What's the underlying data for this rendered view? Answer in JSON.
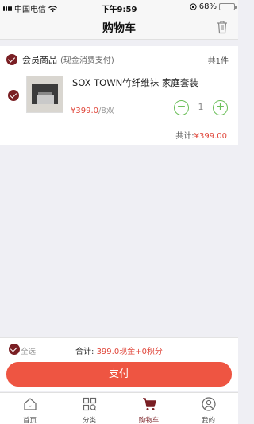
{
  "status_bar": {
    "carrier": "中国电信",
    "time": "下午9:59",
    "battery_percent": "68%",
    "battery_level": 0.68
  },
  "header": {
    "title": "购物车"
  },
  "cart": {
    "group_title": "会员商品",
    "group_subtitle": "(现金消费支付)",
    "item_count": "共1件",
    "item": {
      "name": "SOX TOWN竹纤维袜 家庭套装",
      "price": "¥399.0",
      "unit": "/8双",
      "quantity": "1"
    },
    "group_total_label": "共计:",
    "group_total_amount": "¥399.00"
  },
  "checkout": {
    "select_all_label": "全选",
    "sum_label": "合计:",
    "sum_amount": "399.0现金+0积分",
    "pay_label": "支付"
  },
  "tabbar": {
    "tabs": [
      {
        "label": "首页",
        "icon": "home-icon"
      },
      {
        "label": "分类",
        "icon": "category-icon"
      },
      {
        "label": "购物车",
        "icon": "cart-icon"
      },
      {
        "label": "我的",
        "icon": "profile-icon"
      }
    ],
    "active_index": 2
  },
  "colors": {
    "brand": "#7a1f24",
    "price": "#e0463a",
    "pay_button": "#ee5542",
    "stepper": "#6bbf59"
  }
}
